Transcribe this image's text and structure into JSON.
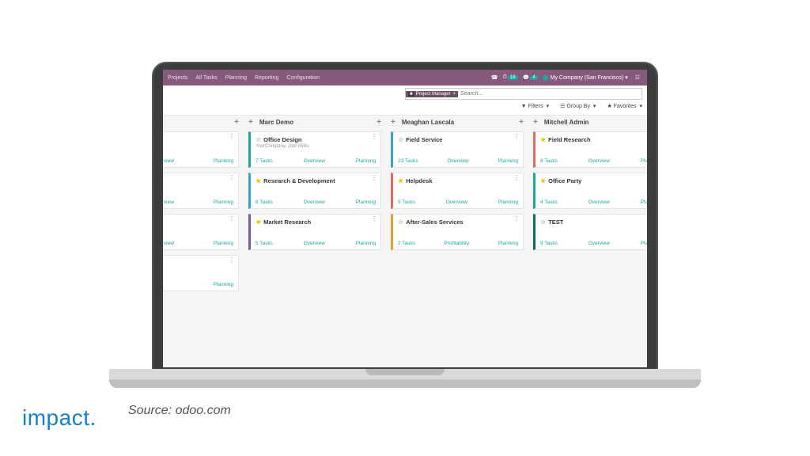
{
  "nav": {
    "projects": "Projects",
    "all_tasks": "All Tasks",
    "planning": "Planning",
    "reporting": "Reporting",
    "config": "Configuration",
    "msg_badge": "18",
    "chat_badge": "4",
    "company": "My Company (San Francisco)"
  },
  "search": {
    "tag": "Project Manager",
    "placeholder": "Search..."
  },
  "filters": {
    "filters": "Filters",
    "group_by": "Group By",
    "favorites": "Favorites"
  },
  "cols": [
    {
      "name": "",
      "cards": [
        {
          "title": "",
          "tasks": "",
          "links": [
            "Overview",
            "Planning"
          ],
          "border": "c-gray",
          "star": ""
        },
        {
          "title": "",
          "tasks": "",
          "links": [
            "Overview",
            "Planning"
          ],
          "border": "c-gray",
          "star": ""
        },
        {
          "title": "",
          "tasks": "",
          "links": [
            "Overview",
            "Planning"
          ],
          "border": "c-gray",
          "star": ""
        },
        {
          "title": "",
          "tasks": "",
          "links": [
            "",
            "Planning"
          ],
          "border": "c-gray",
          "star": ""
        }
      ]
    },
    {
      "name": "Marc Demo",
      "cards": [
        {
          "title": "Office Design",
          "sub": "YourCompany, Joel Willis",
          "tasks": "7 Tasks",
          "links": [
            "Overview",
            "Planning"
          ],
          "border": "c-teal",
          "star": "empty"
        },
        {
          "title": "Research & Development",
          "tasks": "8 Tasks",
          "links": [
            "Overview",
            "Planning"
          ],
          "border": "c-cyan",
          "star": "full"
        },
        {
          "title": "Market Research",
          "tasks": "5 Tasks",
          "links": [
            "Overview",
            "Planning"
          ],
          "border": "c-purple",
          "star": "full"
        }
      ]
    },
    {
      "name": "Meaghan Lascala",
      "cards": [
        {
          "title": "Field Service",
          "tasks": "23 Tasks",
          "links": [
            "Overview",
            "Planning"
          ],
          "border": "c-cyan",
          "star": "empty"
        },
        {
          "title": "Helpdesk",
          "tasks": "9 Tasks",
          "links": [
            "Overview",
            "Planning"
          ],
          "border": "c-red",
          "star": "full"
        },
        {
          "title": "After-Sales Services",
          "tasks": "2 Tasks",
          "links": [
            "Profitability",
            "Planning"
          ],
          "border": "c-orange",
          "star": "empty"
        }
      ]
    },
    {
      "name": "Mitchell Admin",
      "cards": [
        {
          "title": "Field Research",
          "tasks": "8 Tasks",
          "links": [
            "Overview",
            "Planning"
          ],
          "border": "c-red",
          "star": "full"
        },
        {
          "title": "Office Party",
          "tasks": "4 Tasks",
          "links": [
            "Overview",
            "Planning"
          ],
          "border": "c-teal",
          "star": "full"
        },
        {
          "title": "TEST",
          "tasks": "9 Tasks",
          "links": [
            "Overview",
            "Planning"
          ],
          "border": "c-dteal",
          "star": "empty"
        }
      ]
    }
  ],
  "caption": "Source: odoo.com",
  "logo": "impact."
}
